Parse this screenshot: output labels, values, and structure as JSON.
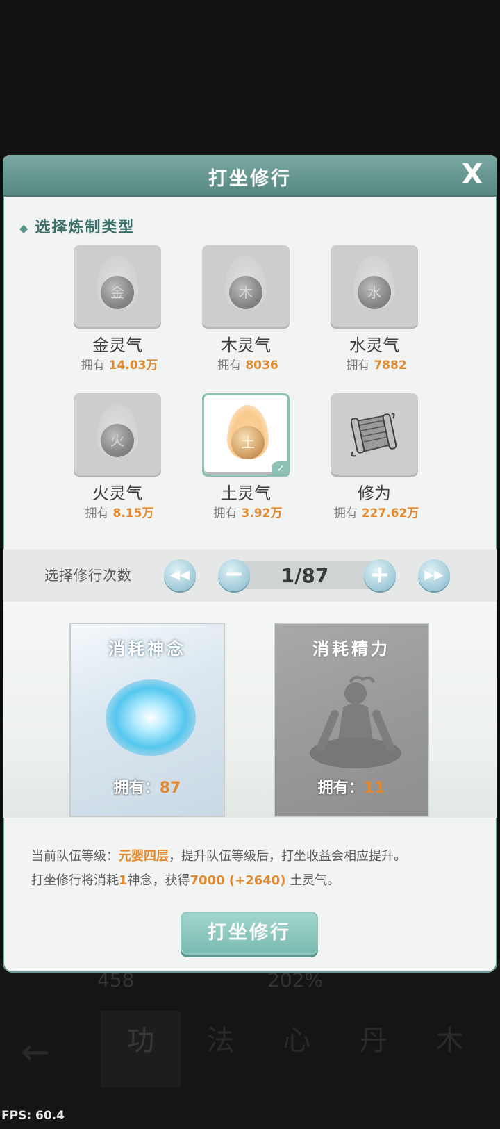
{
  "dialog": {
    "title": "打坐修行",
    "close_label": "X",
    "section_title": "选择炼制类型"
  },
  "types": [
    {
      "glyph": "金",
      "name": "金灵气",
      "owned_label": "拥有",
      "owned_value": "14.03万",
      "selected": false
    },
    {
      "glyph": "木",
      "name": "木灵气",
      "owned_label": "拥有",
      "owned_value": "8036",
      "selected": false
    },
    {
      "glyph": "水",
      "name": "水灵气",
      "owned_label": "拥有",
      "owned_value": "7882",
      "selected": false
    },
    {
      "glyph": "火",
      "name": "火灵气",
      "owned_label": "拥有",
      "owned_value": "8.15万",
      "selected": false
    },
    {
      "glyph": "土",
      "name": "土灵气",
      "owned_label": "拥有",
      "owned_value": "3.92万",
      "selected": true
    },
    {
      "glyph": "",
      "name": "修为",
      "owned_label": "拥有",
      "owned_value": "227.62万",
      "selected": false,
      "icon": "scroll-icon"
    }
  ],
  "count": {
    "label": "选择修行次数",
    "value": "1/87",
    "first_icon": "double-left-arrow-icon",
    "minus_label": "−",
    "plus_label": "+",
    "last_icon": "double-right-arrow-icon"
  },
  "costs": {
    "spirit": {
      "title": "消耗神念",
      "owned_label": "拥有：",
      "owned_value": "87"
    },
    "energy": {
      "title": "消耗精力",
      "owned_label": "拥有：",
      "owned_value": "11"
    }
  },
  "info": {
    "line1_prefix": "当前队伍等级：",
    "line1_level": "元婴四层",
    "line1_suffix": "，提升队伍等级后，打坐收益会相应提升。",
    "line2_prefix": "打坐修行将消耗",
    "line2_cost": "1",
    "line2_mid": "神念，获得",
    "line2_gain": "7000 (+2640)",
    "line2_suffix": " 土灵气。"
  },
  "action_button": "打坐修行",
  "background": {
    "stat1": "458",
    "stat2": "202%",
    "tabs": [
      "功",
      "法",
      "心",
      "丹",
      "木"
    ]
  },
  "fps": "FPS: 60.4",
  "colors": {
    "accent": "#78b9af",
    "highlight": "#e0892e",
    "header": "#578781"
  }
}
